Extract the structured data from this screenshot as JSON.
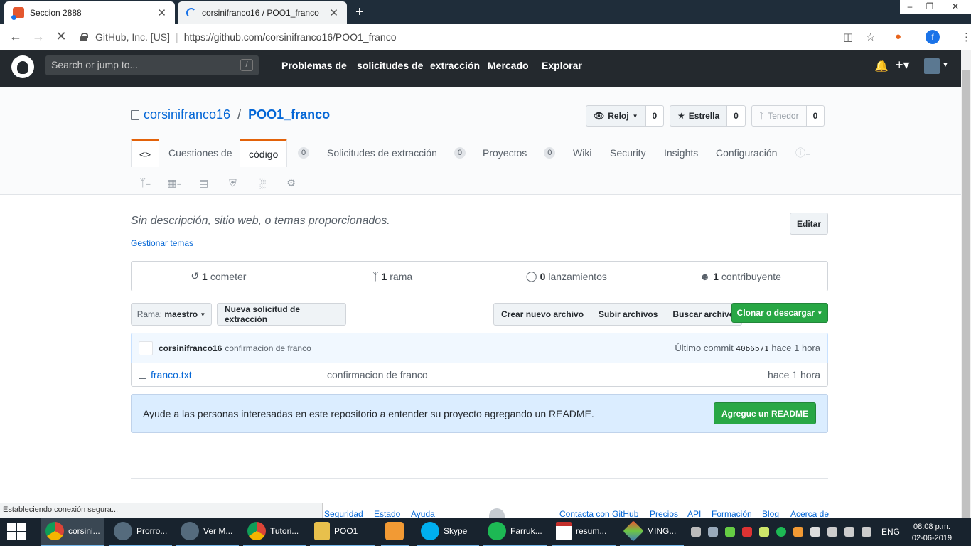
{
  "browser": {
    "tabs": [
      {
        "title": "Seccion 2888",
        "close": "✕"
      },
      {
        "title": "corsinifranco16 / POO1_franco",
        "close": "✕"
      }
    ],
    "new_tab": "+",
    "window_controls": [
      "–",
      "❐",
      "✕"
    ],
    "site_identity": "GitHub, Inc. [US]",
    "url": "https://github.com/corsinifranco16/POO1_franco",
    "url_separator": "|",
    "profile_initial": "f",
    "status_text": "Estableciendo conexión segura..."
  },
  "gh_header": {
    "search_placeholder": "Search or jump to...",
    "search_key": "/",
    "nav": [
      "Problemas de",
      "solicitudes de",
      "extracción",
      "Mercado",
      "Explorar"
    ]
  },
  "repo": {
    "owner": "corsinifranco16",
    "name": "POO1_franco",
    "slash": "/",
    "watch": {
      "label": "Reloj",
      "count": "0"
    },
    "star": {
      "label": "Estrella",
      "count": "0"
    },
    "fork": {
      "label": "Tenedor",
      "count": "0"
    },
    "tabs": {
      "code_symbol": "<>",
      "issues_label": "Cuestiones de",
      "code_label": "código",
      "issues_count": "0",
      "pulls_label": "Solicitudes de extracción",
      "pulls_count": "0",
      "projects_label": "Proyectos",
      "projects_count": "0",
      "wiki": "Wiki",
      "security": "Security",
      "insights": "Insights",
      "settings": "Configuración"
    },
    "description": "Sin descripción, sitio web, o temas proporcionados.",
    "edit_label": "Editar",
    "topics_link": "Gestionar temas",
    "summary": {
      "commits_num": "1",
      "commits_label": "cometer",
      "branches_num": "1",
      "branches_label": "rama",
      "releases_num": "0",
      "releases_label": "lanzamientos",
      "contributors_num": "1",
      "contributors_label": "contribuyente"
    },
    "branch_prefix": "Rama:",
    "branch_name": "maestro",
    "new_pr": "Nueva solicitud de extracción",
    "file_buttons": {
      "create": "Crear nuevo archivo",
      "upload": "Subir archivos",
      "find": "Buscar archivo"
    },
    "clone": "Clonar o descargar",
    "latest_commit": {
      "author": "corsinifranco16",
      "message": "confirmacion de franco",
      "label": "Último commit",
      "sha": "40b6b71",
      "age": "hace 1 hora"
    },
    "files": [
      {
        "name": "franco.txt",
        "message": "confirmacion de franco",
        "age": "hace 1 hora"
      }
    ],
    "readme_prompt": "Ayude a las personas interesadas en este repositorio a entender su proyecto agregando un README.",
    "readme_button": "Agregue un README"
  },
  "footer": {
    "links": [
      "Seguridad",
      "Estado",
      "Ayuda",
      "Contacta con GitHub",
      "Precios",
      "API",
      "Formación",
      "Blog",
      "Acerca de"
    ]
  },
  "taskbar": {
    "items": [
      "corsini...",
      "Prorro...",
      "Ver M...",
      "Tutori...",
      "POO1",
      "Skype",
      "Farruk...",
      "resum...",
      "MING..."
    ],
    "lang": "ENG",
    "time": "08:08 p.m.",
    "date": "02-06-2019"
  },
  "colors": {
    "github_header": "#24292e",
    "link_blue": "#0366d6",
    "green_button": "#28a745",
    "selected_tab_accent": "#e36209",
    "readme_blue": "#dbedff"
  }
}
